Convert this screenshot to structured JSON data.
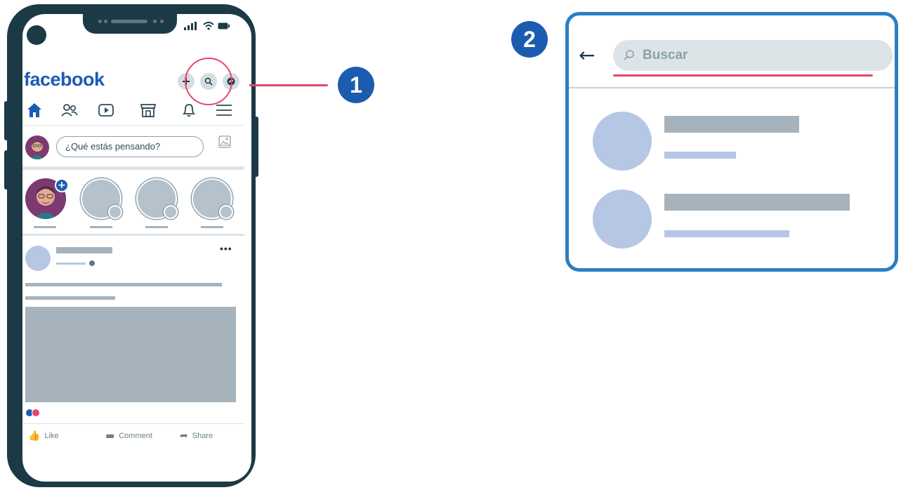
{
  "phone": {
    "app_logo": "facebook",
    "composer_placeholder": "¿Qué estás pensando?",
    "header_icons": [
      "plus-icon",
      "search-icon",
      "messenger-icon"
    ],
    "nav_icons": [
      "home-icon",
      "friends-icon",
      "watch-icon",
      "marketplace-icon",
      "bell-icon",
      "menu-icon"
    ],
    "status_icons": [
      "signal-icon",
      "wifi-icon",
      "battery-icon"
    ],
    "story_add_label": "+",
    "post_menu": "•••",
    "post_actions": {
      "like": "Like",
      "comment": "Comment",
      "share": "Share"
    }
  },
  "callouts": {
    "step_1": "1",
    "step_2": "2"
  },
  "search_panel": {
    "back_glyph": "←",
    "search_placeholder": "Buscar"
  },
  "colors": {
    "brand_blue": "#1c5cb0",
    "phone_frame": "#1c3a45",
    "highlight_red": "#e8456b",
    "panel_border": "#2a7fc2",
    "placeholder_gray": "#a6b3bd",
    "placeholder_blue": "#b5c7e4"
  }
}
